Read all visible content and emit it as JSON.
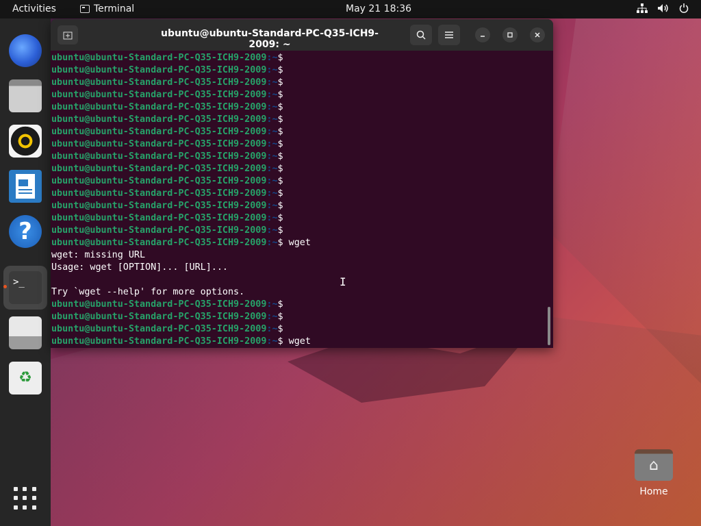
{
  "topbar": {
    "activities": "Activities",
    "app_name": "Terminal",
    "clock": "May 21  18:36",
    "tray_icons": [
      "network-icon",
      "volume-icon",
      "power-icon"
    ]
  },
  "dock": {
    "items": [
      {
        "name": "thunderbird-icon"
      },
      {
        "name": "files-icon"
      },
      {
        "name": "rhythmbox-icon"
      },
      {
        "name": "libreoffice-writer-icon"
      },
      {
        "name": "help-icon",
        "glyph": "?"
      },
      {
        "name": "terminal-icon",
        "glyph": ">_",
        "active": true
      },
      {
        "name": "text-editor-icon"
      },
      {
        "name": "trash-icon",
        "glyph": "♻"
      }
    ]
  },
  "terminal": {
    "title": "ubuntu@ubuntu-Standard-PC-Q35-ICH9-2009: ~",
    "prompt_user": "ubuntu@ubuntu-Standard-PC-Q35-ICH9-2009",
    "prompt_path": ":~",
    "lines": [
      {
        "type": "prompt",
        "cmd": ""
      },
      {
        "type": "prompt",
        "cmd": ""
      },
      {
        "type": "prompt",
        "cmd": ""
      },
      {
        "type": "prompt",
        "cmd": ""
      },
      {
        "type": "prompt",
        "cmd": ""
      },
      {
        "type": "prompt",
        "cmd": ""
      },
      {
        "type": "prompt",
        "cmd": ""
      },
      {
        "type": "prompt",
        "cmd": ""
      },
      {
        "type": "prompt",
        "cmd": ""
      },
      {
        "type": "prompt",
        "cmd": ""
      },
      {
        "type": "prompt",
        "cmd": ""
      },
      {
        "type": "prompt",
        "cmd": ""
      },
      {
        "type": "prompt",
        "cmd": ""
      },
      {
        "type": "prompt",
        "cmd": ""
      },
      {
        "type": "prompt",
        "cmd": ""
      },
      {
        "type": "prompt",
        "cmd": " wget"
      },
      {
        "type": "out",
        "text": "wget: missing URL"
      },
      {
        "type": "out",
        "text": "Usage: wget [OPTION]... [URL]..."
      },
      {
        "type": "out",
        "text": ""
      },
      {
        "type": "out",
        "text": "Try `wget --help' for more options."
      },
      {
        "type": "prompt",
        "cmd": ""
      },
      {
        "type": "prompt",
        "cmd": ""
      },
      {
        "type": "prompt",
        "cmd": ""
      },
      {
        "type": "prompt",
        "cmd": " wget"
      }
    ]
  },
  "desktop": {
    "home_label": "Home"
  }
}
